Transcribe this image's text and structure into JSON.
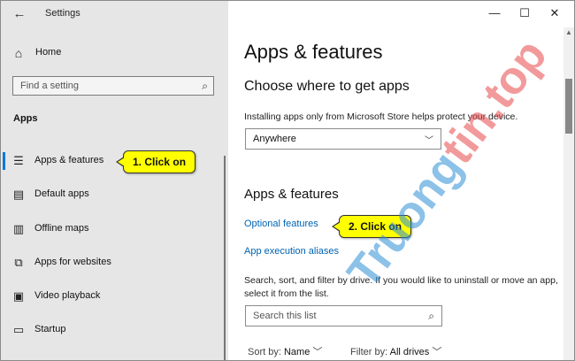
{
  "window": {
    "title": "Settings",
    "controls": {
      "minimize": "—",
      "maximize": "☐",
      "close": "✕"
    }
  },
  "sidebar": {
    "home_label": "Home",
    "search_placeholder": "Find a setting",
    "section_title": "Apps",
    "items": [
      {
        "label": "Apps & features",
        "icon": "apps-list-icon",
        "active": true
      },
      {
        "label": "Default apps",
        "icon": "default-apps-icon"
      },
      {
        "label": "Offline maps",
        "icon": "map-icon"
      },
      {
        "label": "Apps for websites",
        "icon": "web-link-icon"
      },
      {
        "label": "Video playback",
        "icon": "video-icon"
      },
      {
        "label": "Startup",
        "icon": "startup-icon"
      }
    ]
  },
  "main": {
    "title": "Apps & features",
    "choose_heading": "Choose where to get apps",
    "choose_desc": "Installing apps only from Microsoft Store helps protect your device.",
    "source_value": "Anywhere",
    "section_heading": "Apps & features",
    "links": [
      "Optional features",
      "App execution aliases"
    ],
    "list_desc": "Search, sort, and filter by drive. If you would like to uninstall or move an app, select it from the list.",
    "list_search_placeholder": "Search this list",
    "sort_label": "Sort by:",
    "sort_value": "Name",
    "filter_label": "Filter by:",
    "filter_value": "All drives"
  },
  "callouts": [
    "1. Click on",
    "2. Click on"
  ],
  "watermark": {
    "part1": "Truong",
    "part2": "tin.top"
  },
  "colors": {
    "accent": "#0078d7",
    "link": "#0063b1",
    "callout": "#ffff00",
    "sidebar_bg": "#e6e6e6"
  }
}
